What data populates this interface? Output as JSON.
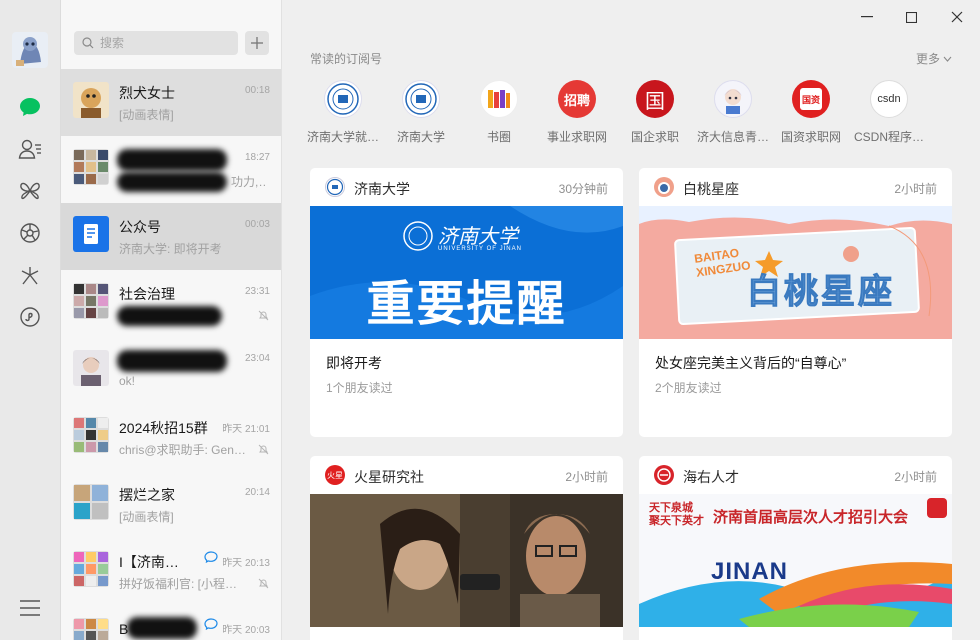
{
  "chat_search": {
    "placeholder": "搜索"
  },
  "chats": [
    {
      "name": "烈犬女士",
      "time": "00:18",
      "preview": "[动画表情]"
    },
    {
      "name": "",
      "time": "18:27",
      "preview": "功力,…"
    },
    {
      "name": "公众号",
      "time": "00:03",
      "preview": "济南大学: 即将开考"
    },
    {
      "name": "社会治理",
      "time": "23:31",
      "preview": ""
    },
    {
      "name": "",
      "time": "23:04",
      "preview": "ok!"
    },
    {
      "name": "2024秋招15群",
      "time": "昨天 21:01",
      "preview": "chris@求职助手: Gen…"
    },
    {
      "name": "摆烂之家",
      "time": "20:14",
      "preview": "[动画表情]"
    },
    {
      "name": "I【济南…",
      "time": "昨天 20:13",
      "preview": "拼好饭福利官: [小程…"
    },
    {
      "name": "B【行…",
      "time": "昨天 20:03",
      "preview": ""
    }
  ],
  "subscriptions": {
    "section_label": "常读的订阅号",
    "more_label": "更多",
    "items": [
      {
        "label": "济南大学就…"
      },
      {
        "label": "济南大学"
      },
      {
        "label": "书圈"
      },
      {
        "label": "事业求职网",
        "logo_text": "招聘"
      },
      {
        "label": "国企求职",
        "logo_text": "国"
      },
      {
        "label": "济大信息青…"
      },
      {
        "label": "国资求职网",
        "logo_text": "国资"
      },
      {
        "label": "CSDN程序…",
        "logo_text": "csdn"
      }
    ]
  },
  "cards": [
    {
      "account": "济南大学",
      "time": "30分钟前",
      "title": "即将开考",
      "readers": "1个朋友读过",
      "banner_text": "重要提醒",
      "banner_logo": "济南大学",
      "banner_sub": "UNIVERSITY OF JINAN"
    },
    {
      "account": "白桃星座",
      "time": "2小时前",
      "title": "处女座完美主义背后的“自尊心”",
      "readers": "2个朋友读过",
      "banner_text": "白桃星座",
      "banner_en1": "BAITAO",
      "banner_en2": "XINGZUO"
    },
    {
      "account": "火星研究社",
      "time": "2小时前",
      "logo_text": "火星"
    },
    {
      "account": "海右人才",
      "time": "2小时前",
      "banner_text": "济南首届高层次人才招引大会",
      "banner_en": "JINAN",
      "banner_slogan1": "天下泉城",
      "banner_slogan2": "聚天下英才"
    }
  ],
  "colors": {
    "accent_green": "#07c160",
    "ujn_blue": "#0b6fd6",
    "peach": "#f4aaa0"
  }
}
